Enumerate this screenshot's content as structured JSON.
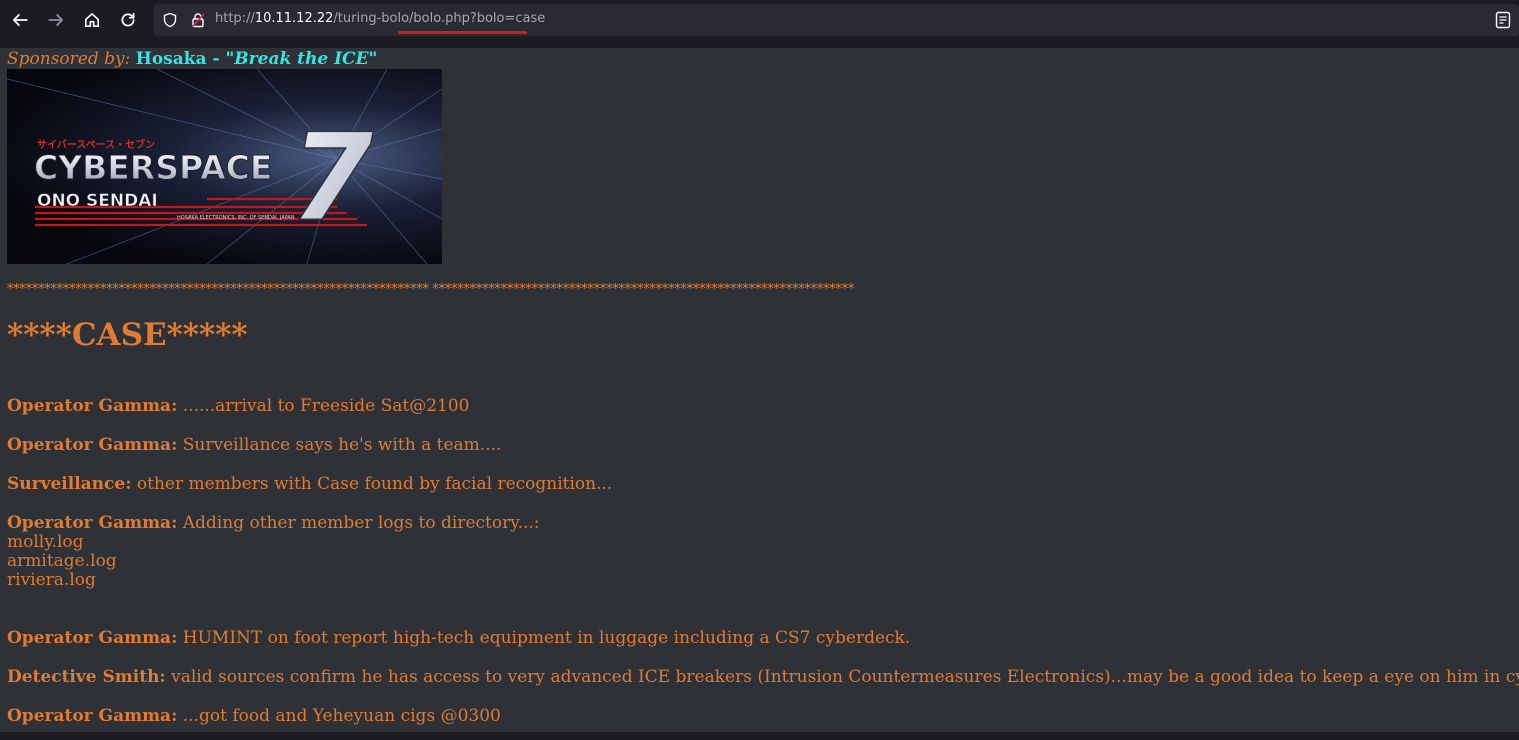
{
  "browser": {
    "url_prefix": "http://",
    "url_host": "10.11.12.22",
    "url_path": "/turing-bolo/bolo.php?bolo=case"
  },
  "page": {
    "sponsor_label": "Sponsored by:",
    "sponsor_brand": "Hosaka - \"",
    "sponsor_tagline": "Break the ICE",
    "sponsor_close": "\"",
    "banner": {
      "japanese": "サイバースペース・セブン",
      "title": "CYBERSPACE",
      "numeral": "7",
      "subtitle": "ONO SENDAI",
      "small": "HOSAKA ELECTRONICS, INC. OF SENDAI, JAPAN"
    },
    "stars": "******************************************************************** ********************************************************************",
    "heading": "****CASE*****",
    "entries": [
      {
        "speaker": "Operator Gamma:",
        "text": " ......arrival to Freeside Sat@2100"
      },
      {
        "speaker": "Operator Gamma:",
        "text": " Surveillance says he's with a team...."
      },
      {
        "speaker": "Surveillance:",
        "text": " other members with Case found by facial recognition..."
      },
      {
        "speaker": "Operator Gamma:",
        "text": " Adding other member logs to directory...:"
      }
    ],
    "logs": [
      "molly.log",
      "armitage.log",
      "riviera.log"
    ],
    "entries2": [
      {
        "speaker": "Operator Gamma:",
        "text": " HUMINT on foot report high-tech equipment in luggage including a CS7 cyberdeck."
      },
      {
        "speaker": "Detective Smith:",
        "text": " valid sources confirm he has access to very advanced ICE breakers (Intrusion Countermeasures Electronics)...may be a good idea to keep a eye on him in cyberspace."
      },
      {
        "speaker": "Operator Gamma:",
        "text": " ...got food and Yeheyuan cigs @0300"
      }
    ]
  },
  "colors": {
    "accent": "#e07b34",
    "cyan": "#33e6e6",
    "background": "#2e3136",
    "chrome": "#1c1b22"
  }
}
